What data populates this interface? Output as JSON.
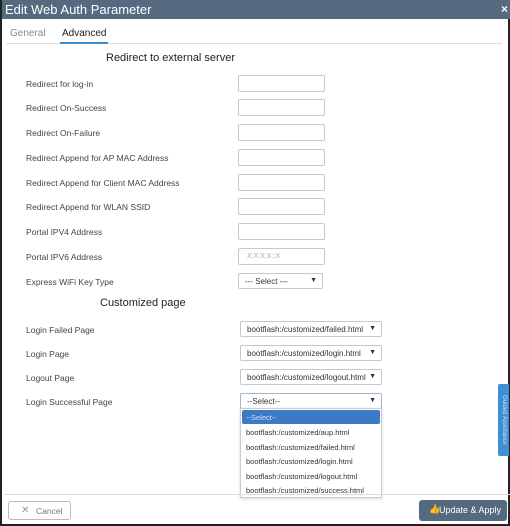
{
  "dialog": {
    "title": "Edit Web Auth Parameter",
    "close_icon": "×"
  },
  "tabs": [
    {
      "label": "General",
      "active": false
    },
    {
      "label": "Advanced",
      "active": true
    }
  ],
  "redirect_section": {
    "heading": "Redirect to external server",
    "fields": [
      {
        "label": "Redirect for log-in",
        "value": "",
        "placeholder": ""
      },
      {
        "label": "Redirect On-Success",
        "value": "",
        "placeholder": ""
      },
      {
        "label": "Redirect On-Failure",
        "value": "",
        "placeholder": ""
      },
      {
        "label": "Redirect Append for AP MAC Address",
        "value": "",
        "placeholder": ""
      },
      {
        "label": "Redirect Append for Client MAC Address",
        "value": "",
        "placeholder": ""
      },
      {
        "label": "Redirect Append for WLAN SSID",
        "value": "",
        "placeholder": ""
      },
      {
        "label": "Portal IPV4 Address",
        "value": "",
        "placeholder": ""
      },
      {
        "label": "Portal IPV6 Address",
        "value": "",
        "placeholder": "X:X:X:X::X"
      }
    ],
    "express_wifi": {
      "label": "Express WiFi Key Type",
      "selected": "--- Select ---"
    }
  },
  "customized_section": {
    "heading": "Customized page",
    "fields": [
      {
        "label": "Login Failed Page",
        "selected": "bootflash:/customized/failed.html"
      },
      {
        "label": "Login Page",
        "selected": "bootflash:/customized/login.html"
      },
      {
        "label": "Logout Page",
        "selected": "bootflash:/customized/logout.html"
      },
      {
        "label": "Login Successful Page",
        "selected": "--Select--"
      }
    ],
    "open_dropdown_options": [
      "--Select--",
      "bootflash:/customized/aup.html",
      "bootflash:/customized/failed.html",
      "bootflash:/customized/login.html",
      "bootflash:/customized/logout.html",
      "bootflash:/customized/success.html"
    ],
    "highlighted_option": "--Select--"
  },
  "footer": {
    "cancel_label": "Cancel",
    "apply_label": "Update & Apply"
  },
  "side_tab": {
    "label": "Guided Assistance",
    "color": "#3f8fd6"
  },
  "colors": {
    "titlebar": "#566a7f",
    "accent": "#3b8fd4",
    "dropdown_highlight": "#3d7ac6"
  }
}
